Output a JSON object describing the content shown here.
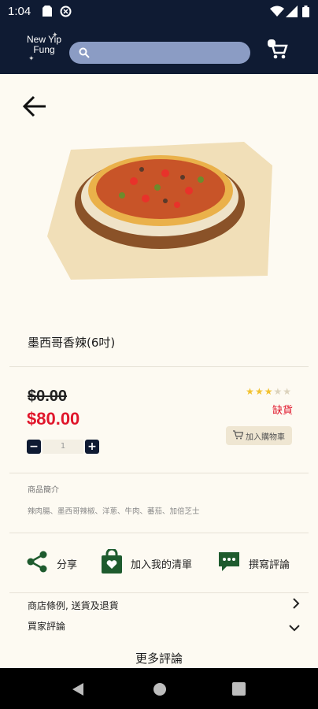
{
  "status_bar": {
    "time": "1:04"
  },
  "header": {
    "logo_line1": "New Yip",
    "logo_line2": "Fung",
    "search_placeholder": ""
  },
  "product": {
    "name": "墨西哥香辣(6吋)",
    "original_price": "$0.00",
    "price": "$80.00",
    "rating": 3,
    "rating_max": 5,
    "stock_status": "缺貨",
    "add_to_cart_label": "加入購物車",
    "quantity": "1",
    "description_label": "商品簡介",
    "description": "辣肉腸、墨西哥辣椒、洋蔥、牛肉、蕃茄、加倍芝士"
  },
  "actions": {
    "share_label": "分享",
    "wishlist_label": "加入我的清單",
    "review_label": "撰寫評論"
  },
  "links": {
    "policy_label": "商店條例, 送貨及退貨",
    "buyer_reviews_label": "買家評論",
    "more_reviews_label": "更多評論"
  },
  "colors": {
    "header_bg": "#0f1b33",
    "price_red": "#e0162b",
    "icon_green": "#1e5b2e",
    "star_gold": "#f2c230"
  }
}
